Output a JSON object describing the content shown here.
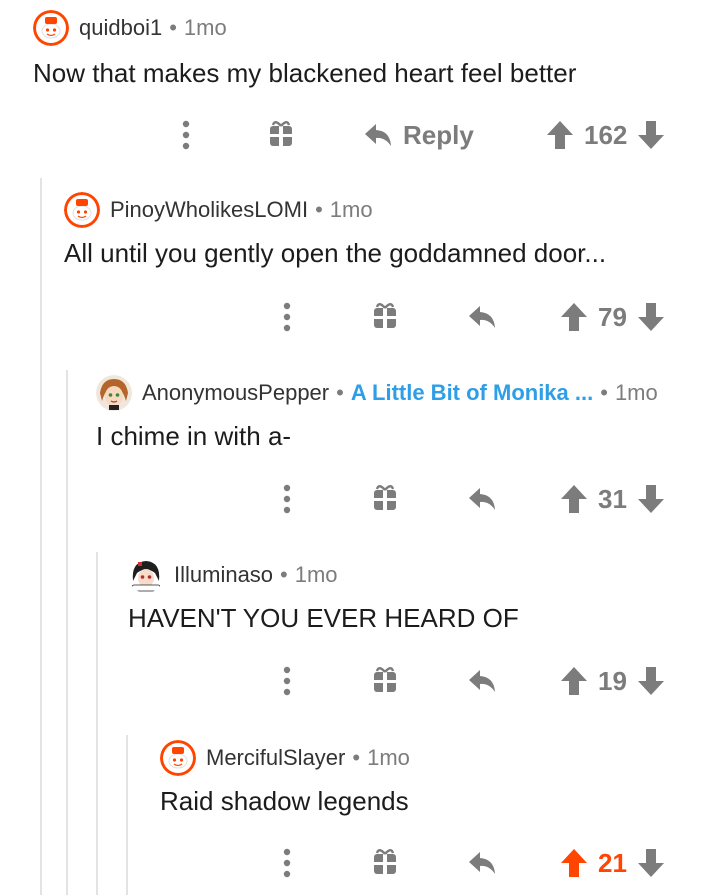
{
  "colors": {
    "upvoted": "#ff4500",
    "flair": "#2e9ee6",
    "muted": "#7c7c7c",
    "thread_line": "#e3e3e3"
  },
  "icons": {
    "more": "more-dots-icon",
    "award": "award-gift-icon",
    "reply": "reply-arrow-icon",
    "upvote": "upvote-arrow-icon",
    "downvote": "downvote-arrow-icon"
  },
  "comments": [
    {
      "username": "quidboi1",
      "separator": "•",
      "time": "1mo",
      "body": "Now that makes my blackened heart feel better",
      "reply_label": "Reply",
      "score": "162",
      "avatar": "snoo-avatar",
      "upvoted": false
    },
    {
      "username": "PinoyWholikesLOMI",
      "separator": "•",
      "time": "1mo",
      "body": "All until you gently open the goddamned door...",
      "score": "79",
      "avatar": "snoo-avatar",
      "upvoted": false
    },
    {
      "username": "AnonymousPepper",
      "separator": "•",
      "flair": "A Little Bit of Monika ...",
      "time": "1mo",
      "body": "I chime in with a-",
      "score": "31",
      "avatar": "anime-avatar",
      "upvoted": false
    },
    {
      "username": "Illuminaso",
      "separator": "•",
      "time": "1mo",
      "body": "HAVEN'T YOU EVER HEARD OF",
      "score": "19",
      "avatar": "anime-avatar",
      "upvoted": false
    },
    {
      "username": "MercifulSlayer",
      "separator": "•",
      "time": "1mo",
      "body": "Raid shadow legends",
      "score": "21",
      "avatar": "snoo-avatar",
      "upvoted": true
    }
  ]
}
